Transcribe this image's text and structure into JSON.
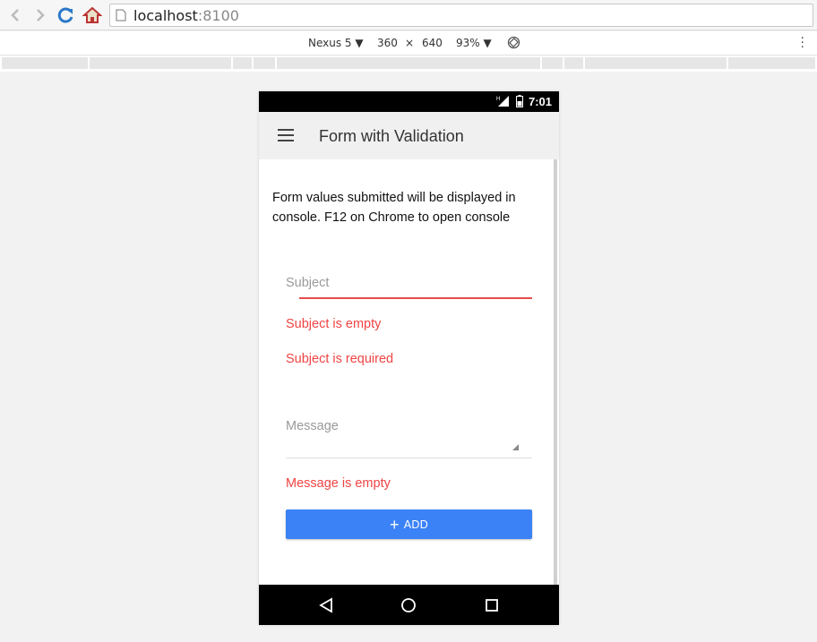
{
  "browser": {
    "url_host": "localhost",
    "url_port": ":8100"
  },
  "devtools": {
    "device": "Nexus 5",
    "width": "360",
    "times": "×",
    "height": "640",
    "zoom": "93%"
  },
  "status_bar": {
    "network": "H",
    "time": "7:01"
  },
  "app": {
    "title": "Form with Validation",
    "intro": "Form values submitted will be displayed in console. F12 on Chrome to open console",
    "subject": {
      "placeholder": "Subject",
      "errors": [
        "Subject is empty",
        "Subject is required"
      ]
    },
    "message": {
      "placeholder": "Message",
      "errors": [
        "Message is empty"
      ]
    },
    "add_button": "ADD"
  },
  "colors": {
    "error": "#ef4444",
    "primary_button": "#3b82f6"
  }
}
